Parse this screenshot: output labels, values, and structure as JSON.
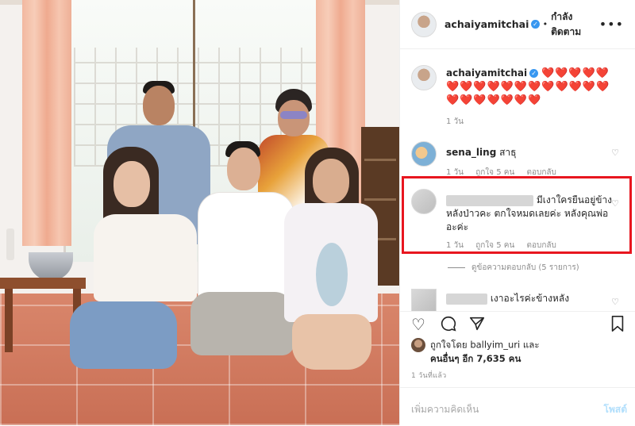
{
  "header": {
    "username": "achaiyamitchai",
    "separator": "•",
    "follow_state": "กำลังติดตาม",
    "more_icon": "more-horizontal-icon"
  },
  "caption": {
    "username": "achaiyamitchai",
    "text": "❤️❤️❤️❤️❤️❤️❤️❤️❤️❤️❤️❤️❤️❤️❤️❤️❤️❤️❤️❤️❤️❤️❤️❤️",
    "time": "1 วัน"
  },
  "comments": [
    {
      "username": "sena_ling",
      "text": "สาธุ",
      "time": "1 วัน",
      "likes": "ถูกใจ 5 คน",
      "reply": "ตอบกลับ"
    },
    {
      "username": "",
      "text": "มีเงาใครยืนอยู่ข้างหลังป่าวคะ ตกใจหมดเลยค่ะ หลังคุณพ่ออะค่ะ",
      "time": "1 วัน",
      "likes": "ถูกใจ 5 คน",
      "reply": "ตอบกลับ"
    },
    {
      "username": "",
      "text": "เงาอะไรค่ะข้างหลัง",
      "time": "",
      "likes": "",
      "reply": ""
    }
  ],
  "view_replies": "ดูข้อความตอบกลับ (5 รายการ)",
  "actions": {
    "like_icon": "heart-icon",
    "comment_icon": "comment-icon",
    "share_icon": "share-icon",
    "save_icon": "bookmark-icon"
  },
  "likes": {
    "line1": "ถูกใจโดย ballyim_uri และ",
    "line2": "คนอื่นๆ อีก 7,635 คน"
  },
  "post_time": "1 วันที่แล้ว",
  "add_comment": {
    "placeholder": "เพิ่มความคิดเห็น",
    "post_label": "โพสต์"
  },
  "colors": {
    "highlight": "#e8161f",
    "verified": "#3897f0",
    "post_button": "#b2dffc"
  }
}
